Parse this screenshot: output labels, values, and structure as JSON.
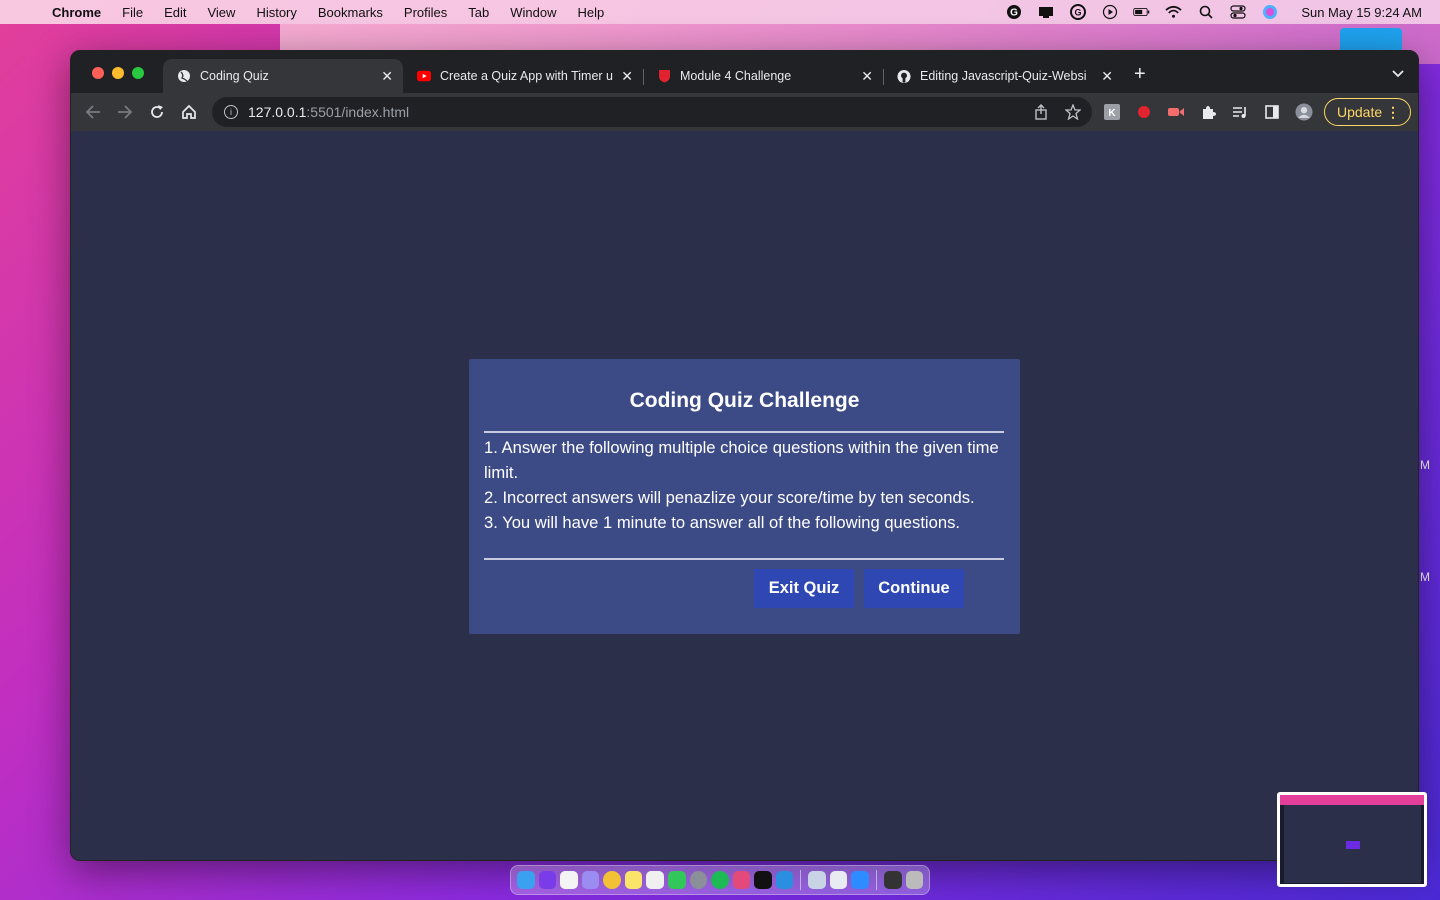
{
  "menubar": {
    "app": "Chrome",
    "items": [
      "File",
      "Edit",
      "View",
      "History",
      "Bookmarks",
      "Profiles",
      "Tab",
      "Window",
      "Help"
    ],
    "clock": "Sun May 15  9:24 AM",
    "tray_icons": [
      "grammarly-icon",
      "display-icon",
      "grammarly-g-icon",
      "play-icon",
      "battery-icon",
      "wifi-icon",
      "spotlight-icon",
      "control-center-icon",
      "siri-icon"
    ]
  },
  "browser": {
    "tabs": [
      {
        "title": "Coding Quiz",
        "icon": "globe-icon",
        "active": true
      },
      {
        "title": "Create a Quiz App with Timer u",
        "icon": "youtube-icon",
        "active": false
      },
      {
        "title": "Module 4 Challenge",
        "icon": "shield-icon",
        "active": false
      },
      {
        "title": "Editing Javascript-Quiz-Websi",
        "icon": "github-icon",
        "active": false
      }
    ],
    "url_host": "127.0.0.1",
    "url_path": ":5501/index.html",
    "update_label": "Update"
  },
  "quiz": {
    "title": "Coding Quiz Challenge",
    "rules": [
      "1. Answer the following multiple choice questions within the given time limit.",
      "2. Incorrect answers will penazlize your score/time by ten seconds.",
      "3. You will have 1 minute to answer all of the following questions."
    ],
    "exit_label": "Exit Quiz",
    "continue_label": "Continue"
  },
  "colors": {
    "page_bg": "#2b2f49",
    "card_bg": "#3c4a86",
    "button_bg": "#2f47b3",
    "update_accent": "#fdd663"
  }
}
